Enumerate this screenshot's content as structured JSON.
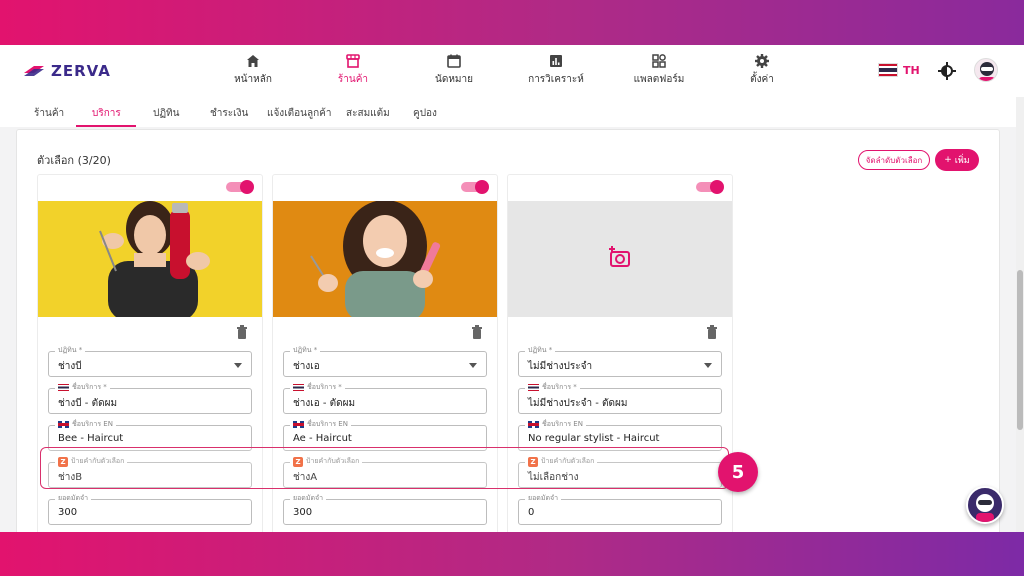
{
  "app": {
    "brand": "ZERVA"
  },
  "nav": [
    {
      "label": "หน้าหลัก",
      "icon": "home-icon"
    },
    {
      "label": "ร้านค้า",
      "icon": "store-icon"
    },
    {
      "label": "นัดหมาย",
      "icon": "calendar-icon"
    },
    {
      "label": "การวิเคราะห์",
      "icon": "analytics-icon"
    },
    {
      "label": "แพลตฟอร์ม",
      "icon": "apps-icon"
    },
    {
      "label": "ตั้งค่า",
      "icon": "gear-icon"
    }
  ],
  "header": {
    "lang_code": "TH"
  },
  "tabs": [
    "ร้านค้า",
    "บริการ",
    "ปฏิทิน",
    "ชำระเงิน",
    "แจ้งเตือนลูกค้า",
    "สะสมแต้ม",
    "คูปอง"
  ],
  "panel": {
    "title": "ตัวเลือก (3/20)",
    "reorder_label": "จัดลำดับตัวเลือก",
    "add_label": "เพิ่ม"
  },
  "labels": {
    "calendar": "ปฏิทิน *",
    "service_name": "ชื่อบริการ *",
    "service_name_en": "ชื่อบริการ EN",
    "option_tag": "ป้ายคำกับตัวเลือก",
    "deposit": "ยอดมัดจำ"
  },
  "cards": [
    {
      "calendar": "ช่างบี",
      "name_th": "ช่างบี - ตัดผม",
      "name_en": "Bee - Haircut",
      "tag": "ช่างB",
      "deposit": "300",
      "enabled": true
    },
    {
      "calendar": "ช่างเอ",
      "name_th": "ช่างเอ - ตัดผม",
      "name_en": "Ae - Haircut",
      "tag": "ช่างA",
      "deposit": "300",
      "enabled": true
    },
    {
      "calendar": "ไม่มีช่างประจำ",
      "name_th": "ไม่มีช่างประจำ - ตัดผม",
      "name_en": "No regular stylist - Haircut",
      "tag": "ไม่เลือกช่าง",
      "deposit": "0",
      "enabled": true
    }
  ],
  "step": "5",
  "colors": {
    "accent": "#e2136e",
    "brand": "#3b2a8a"
  }
}
